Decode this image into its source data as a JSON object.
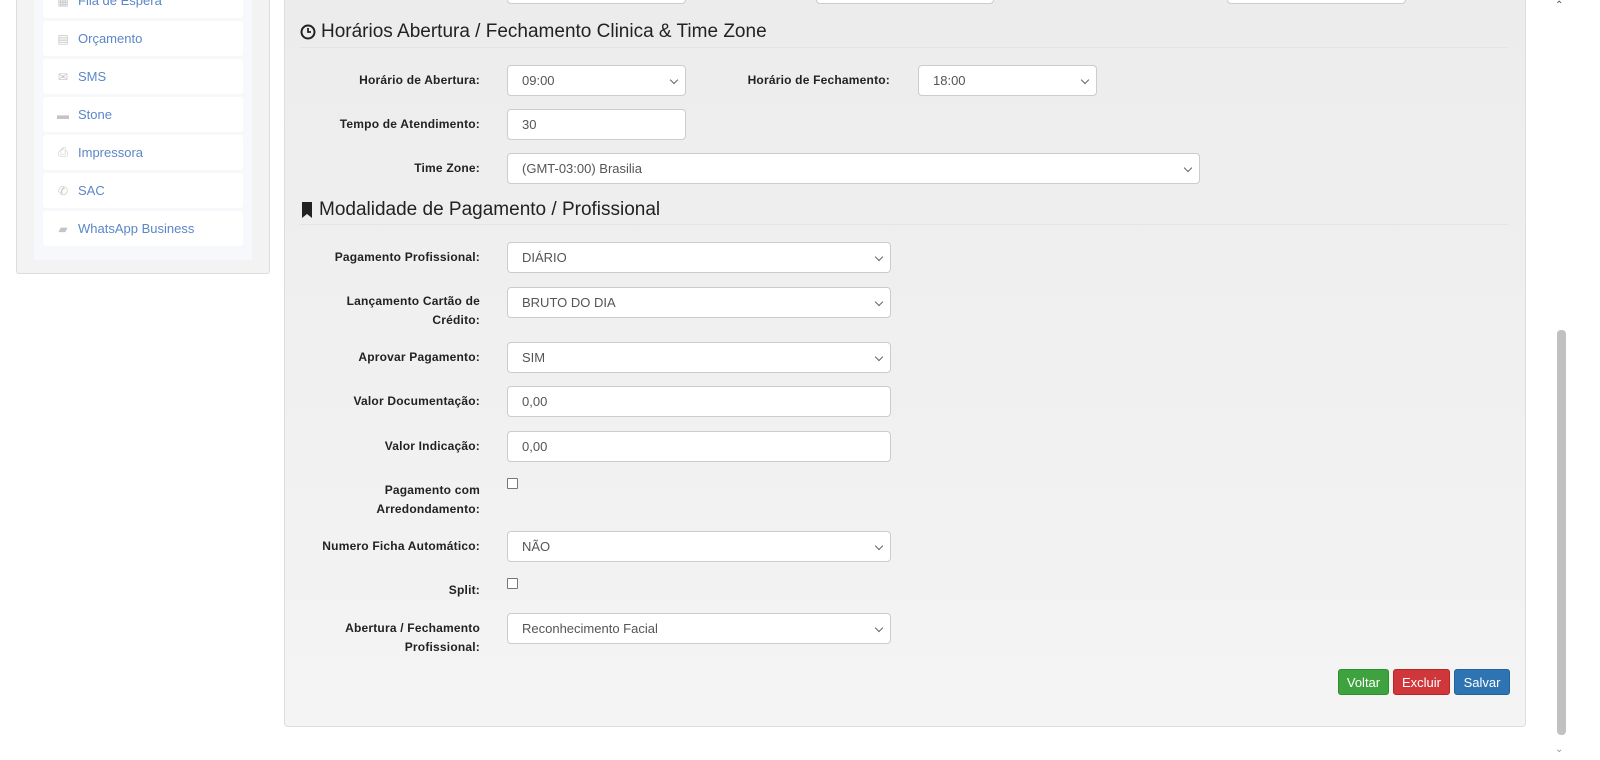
{
  "sidebar": {
    "items": [
      {
        "label": "Fila de Espera",
        "icon": "grid-icon"
      },
      {
        "label": "Orçamento",
        "icon": "list-icon"
      },
      {
        "label": "SMS",
        "icon": "envelope-icon"
      },
      {
        "label": "Stone",
        "icon": "credit-card-icon"
      },
      {
        "label": "Impressora",
        "icon": "printer-icon"
      },
      {
        "label": "SAC",
        "icon": "phone-icon"
      },
      {
        "label": "WhatsApp Business",
        "icon": "comment-icon"
      }
    ]
  },
  "section1": {
    "title": "Horários Abertura / Fechamento Clinica & Time Zone",
    "opening_label": "Horário de Abertura:",
    "opening_value": "09:00",
    "closing_label": "Horário de Fechamento:",
    "closing_value": "18:00",
    "service_time_label": "Tempo de Atendimento:",
    "service_time_value": "30",
    "timezone_label": "Time Zone:",
    "timezone_value": "(GMT-03:00) Brasilia"
  },
  "section2": {
    "title": "Modalidade de Pagamento / Profissional",
    "pay_prof_label": "Pagamento Profissional:",
    "pay_prof_value": "DIÁRIO",
    "card_l1": "Lançamento Cartão de",
    "card_l2": "Crédito:",
    "card_value": "BRUTO DO DIA",
    "approve_label": "Aprovar Pagamento:",
    "approve_value": "SIM",
    "doc_label": "Valor Documentação:",
    "doc_value": "0,00",
    "ind_label": "Valor Indicação:",
    "ind_value": "0,00",
    "round_l1": "Pagamento com",
    "round_l2": "Arredondamento:",
    "round_checked": false,
    "ficha_label": "Numero Ficha Automático:",
    "ficha_value": "NÃO",
    "split_label": "Split:",
    "split_checked": false,
    "openclose_l1": "Abertura / Fechamento",
    "openclose_l2": "Profissional:",
    "openclose_value": "Reconhecimento Facial"
  },
  "buttons": {
    "back": "Voltar",
    "delete": "Excluir",
    "save": "Salvar"
  },
  "colors": {
    "back": "#3ea23e",
    "delete": "#d0373a",
    "save": "#2e74b3",
    "link": "#5b86c9"
  }
}
